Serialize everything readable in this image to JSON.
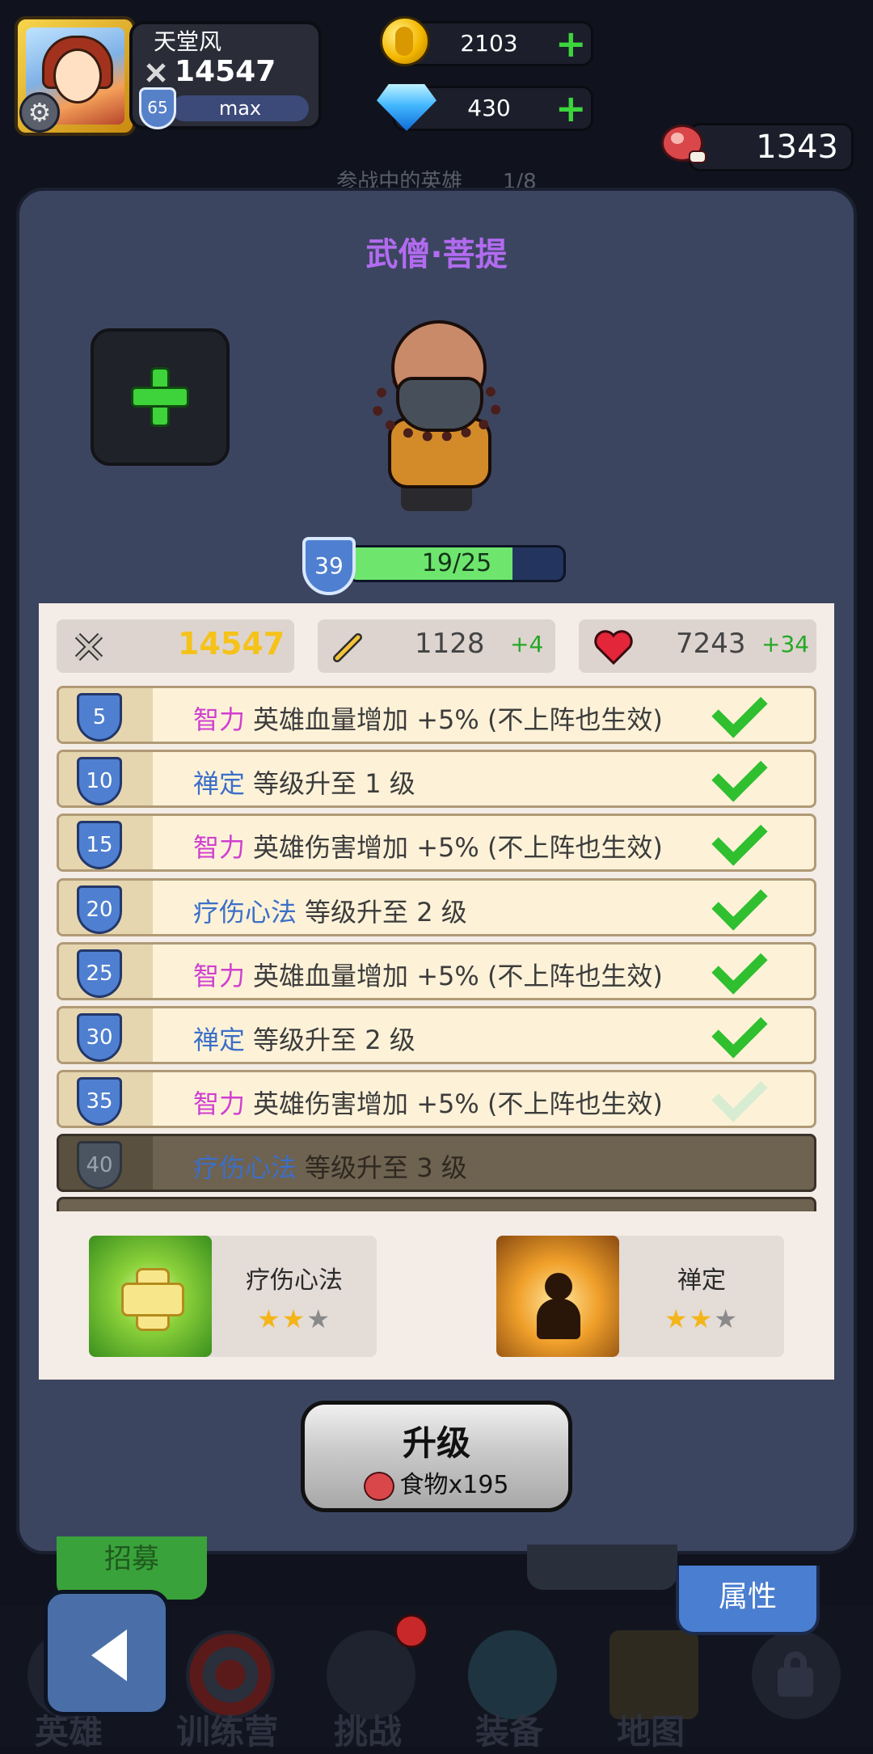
{
  "player": {
    "name": "天堂风",
    "power": "14547",
    "level": "65",
    "level_label": "max"
  },
  "currency": {
    "gold": "2103",
    "gems": "430",
    "meat": "1343"
  },
  "background": {
    "title": "参战中的英雄",
    "count": "1/8",
    "tab_left": "招募"
  },
  "hero": {
    "name": "武僧·菩提",
    "level": "39",
    "xp": "19/25",
    "xp_progress": 0.76
  },
  "stats": {
    "power": "14547",
    "attack": "1128",
    "attack_bonus": "+4",
    "hp": "7243",
    "hp_bonus": "+34"
  },
  "talents": [
    {
      "level": "5",
      "key": "智力",
      "key_color": "#d03fd0",
      "text": "英雄血量增加 +5% (不上阵也生效)",
      "done": true
    },
    {
      "level": "10",
      "key": "禅定",
      "key_color": "#3c6fc8",
      "text": "等级升至 1 级",
      "done": true
    },
    {
      "level": "15",
      "key": "智力",
      "key_color": "#d03fd0",
      "text": "英雄伤害增加 +5% (不上阵也生效)",
      "done": true
    },
    {
      "level": "20",
      "key": "疗伤心法",
      "key_color": "#3c6fc8",
      "text": "等级升至 2 级",
      "done": true
    },
    {
      "level": "25",
      "key": "智力",
      "key_color": "#d03fd0",
      "text": "英雄血量增加 +5% (不上阵也生效)",
      "done": true
    },
    {
      "level": "30",
      "key": "禅定",
      "key_color": "#3c6fc8",
      "text": "等级升至 2 级",
      "done": true
    },
    {
      "level": "35",
      "key": "智力",
      "key_color": "#d03fd0",
      "text": "英雄伤害增加 +5% (不上阵也生效)",
      "done": true
    },
    {
      "level": "40",
      "key": "疗伤心法",
      "key_color": "#3c6fc8",
      "text": "等级升至 3 级",
      "done": false
    }
  ],
  "skills": [
    {
      "name": "疗伤心法",
      "stars_on": "★★",
      "stars_off": "★"
    },
    {
      "name": "禅定",
      "stars_on": "★★",
      "stars_off": "★"
    }
  ],
  "upgrade": {
    "label": "升级",
    "cost": "食物x195"
  },
  "tabs": {
    "attribute": "属性"
  },
  "nav": [
    {
      "label": "英雄",
      "icon": "hero-icon"
    },
    {
      "label": "训练营",
      "icon": "target-icon"
    },
    {
      "label": "挑战",
      "icon": "shield-sword-icon"
    },
    {
      "label": "装备",
      "icon": "armor-icon"
    },
    {
      "label": "地图",
      "icon": "map-icon"
    },
    {
      "label": "",
      "icon": "lock-icon"
    }
  ],
  "colors": {
    "hero_name": "#b26bf0",
    "bonus_green": "#26a826",
    "power_gold": "#f5c21a"
  }
}
